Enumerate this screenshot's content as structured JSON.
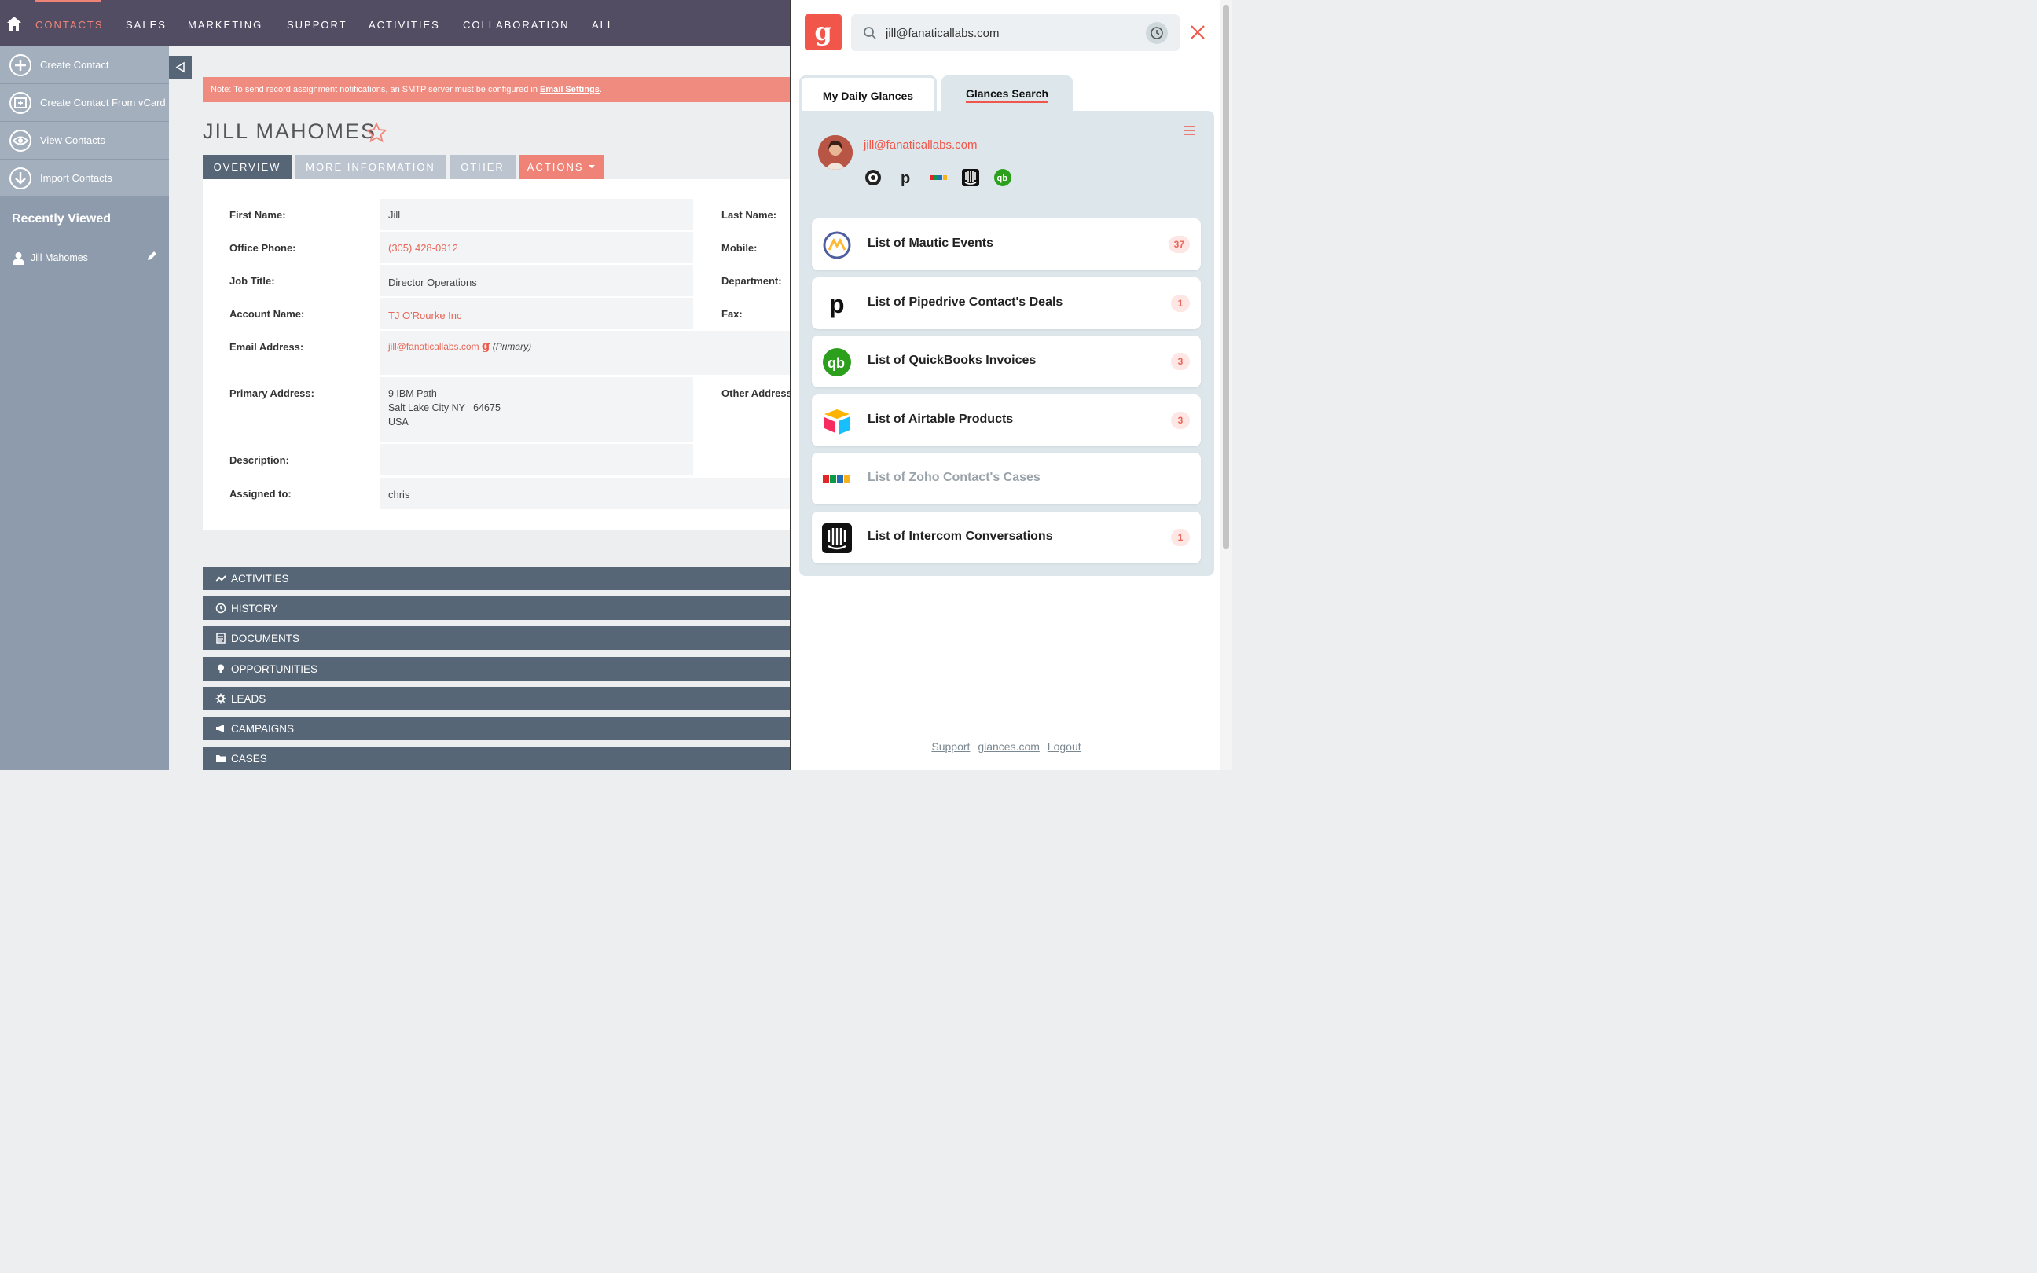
{
  "nav": {
    "items": [
      "CONTACTS",
      "SALES",
      "MARKETING",
      "SUPPORT",
      "ACTIVITIES",
      "COLLABORATION",
      "ALL"
    ],
    "active": "CONTACTS",
    "home_icon": "home-icon"
  },
  "sidebar": {
    "actions": [
      {
        "label": "Create Contact",
        "icon": "plus-circle-icon"
      },
      {
        "label": "Create Contact From vCard",
        "icon": "vcard-icon"
      },
      {
        "label": "View Contacts",
        "icon": "eye-icon"
      },
      {
        "label": "Import Contacts",
        "icon": "download-icon"
      }
    ],
    "recent_title": "Recently Viewed",
    "recent_items": [
      {
        "label": "Jill Mahomes"
      }
    ]
  },
  "note": {
    "text": "Note: To send record assignment notifications, an SMTP server must be configured in ",
    "link": "Email Settings",
    "suffix": "."
  },
  "record": {
    "title": "JILL MAHOMES",
    "tabs": [
      "OVERVIEW",
      "MORE INFORMATION",
      "OTHER",
      "ACTIONS"
    ],
    "fields": {
      "first_name_label": "First Name:",
      "first_name": "Jill",
      "last_name_label": "Last Name:",
      "office_phone_label": "Office Phone:",
      "office_phone": "(305) 428-0912",
      "mobile_label": "Mobile:",
      "job_title_label": "Job Title:",
      "job_title": "Director Operations",
      "department_label": "Department:",
      "account_label": "Account Name:",
      "account": "TJ O'Rourke Inc",
      "fax_label": "Fax:",
      "email_label": "Email Address:",
      "email": "jill@fanaticallabs.com",
      "email_primary": "(Primary)",
      "primary_address_label": "Primary Address:",
      "address_line1": "9 IBM Path",
      "address_line2": "Salt Lake City NY   64675",
      "address_line3": "USA",
      "other_address_label": "Other Address:",
      "description_label": "Description:",
      "assigned_label": "Assigned to:",
      "assigned": "chris"
    },
    "subpanels": [
      "ACTIVITIES",
      "HISTORY",
      "DOCUMENTS",
      "OPPORTUNITIES",
      "LEADS",
      "CAMPAIGNS",
      "CASES"
    ]
  },
  "glances": {
    "search_value": "jill@fanaticallabs.com",
    "tabs": [
      "My Daily Glances",
      "Glances Search"
    ],
    "active_tab": "Glances Search",
    "contact_email": "jill@fanaticallabs.com",
    "services": [
      "mailchimp-icon",
      "pipedrive-icon",
      "zoho-icon",
      "intercom-icon",
      "quickbooks-icon"
    ],
    "cards": [
      {
        "title": "List of Mautic Events",
        "count": "37",
        "icon": "mautic-icon"
      },
      {
        "title": "List of Pipedrive Contact's Deals",
        "count": "1",
        "icon": "pipedrive-icon"
      },
      {
        "title": "List of QuickBooks Invoices",
        "count": "3",
        "icon": "quickbooks-icon"
      },
      {
        "title": "List of Airtable Products",
        "count": "3",
        "icon": "airtable-icon"
      },
      {
        "title": "List of Zoho Contact's Cases",
        "count": "",
        "icon": "zoho-icon"
      },
      {
        "title": "List of Intercom Conversations",
        "count": "1",
        "icon": "intercom-icon"
      }
    ],
    "footer": [
      "Support",
      "glances.com",
      "Logout"
    ]
  },
  "colors": {
    "accent": "#f08377",
    "nav_bg": "#534d64",
    "sidebar_bg": "#8d9bac",
    "subpanel_bg": "#566676",
    "glances_red": "#f0574a"
  }
}
